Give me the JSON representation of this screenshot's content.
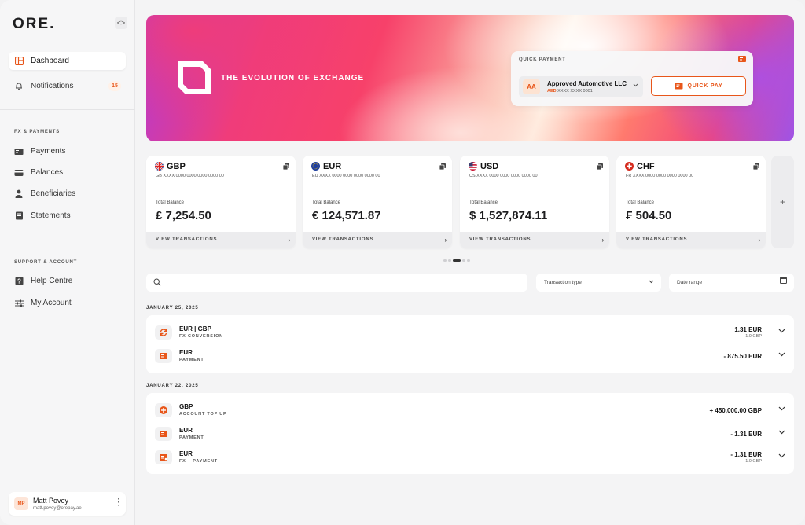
{
  "brand": {
    "logo": "ORE."
  },
  "sidebar": {
    "collapse_icon": "<>",
    "primary": [
      {
        "label": "Dashboard",
        "icon": "dashboard-icon"
      },
      {
        "label": "Notifications",
        "icon": "bell-icon",
        "badge": "15"
      }
    ],
    "fx_section_label": "FX & PAYMENTS",
    "fx_items": [
      {
        "label": "Payments",
        "icon": "payment-icon"
      },
      {
        "label": "Balances",
        "icon": "wallet-icon"
      },
      {
        "label": "Beneficiaries",
        "icon": "person-icon"
      },
      {
        "label": "Statements",
        "icon": "statement-icon"
      }
    ],
    "support_section_label": "SUPPORT & ACCOUNT",
    "support_items": [
      {
        "label": "Help Centre",
        "icon": "help-icon"
      },
      {
        "label": "My Account",
        "icon": "sliders-icon"
      }
    ],
    "user": {
      "initials": "MP",
      "name": "Matt Povey",
      "email": "matt.povey@orepay.ae"
    }
  },
  "hero": {
    "title": "THE EVOLUTION OF EXCHANGE",
    "quick_payment": {
      "label": "QUICK PAYMENT",
      "beneficiary_initials": "AA",
      "beneficiary_name": "Approved Automotive LLC",
      "beneficiary_currency": "AED",
      "beneficiary_account": "XXXX XXXX 0001",
      "button_label": "QUICK PAY"
    }
  },
  "balances": {
    "total_label": "Total Balance",
    "footer_label": "VIEW TRANSACTIONS",
    "add_label": "+",
    "cards": [
      {
        "code": "GBP",
        "iban": "GB XXXX 0000 0000 0000 0000 00",
        "balance": "£ 7,254.50"
      },
      {
        "code": "EUR",
        "iban": "EU XXXX 0000 0000 0000 0000 00",
        "balance": "€ 124,571.87"
      },
      {
        "code": "USD",
        "iban": "US XXXX 0000 0000 0000 0000 00",
        "balance": "$ 1,527,874.11"
      },
      {
        "code": "CHF",
        "iban": "FR XXXX 0000 0000 0000 0000 00",
        "balance": "₣ 504.50"
      }
    ]
  },
  "filters": {
    "search_placeholder": "",
    "transaction_type": "Transaction type",
    "date_range": "Date range"
  },
  "transactions": [
    {
      "date": "JANUARY 25, 2025",
      "items": [
        {
          "title": "EUR | GBP",
          "subtitle": "FX CONVERSION",
          "amount": "1.31 EUR",
          "rate": "1.0 GBP",
          "icon": "exchange-icon"
        },
        {
          "title": "EUR",
          "subtitle": "PAYMENT",
          "amount": "- 875.50 EUR",
          "rate": "",
          "icon": "payment-icon"
        }
      ]
    },
    {
      "date": "JANUARY 22, 2025",
      "items": [
        {
          "title": "GBP",
          "subtitle": "ACCOUNT TOP UP",
          "amount": "+ 450,000.00 GBP",
          "rate": "",
          "icon": "plus-circle-icon"
        },
        {
          "title": "EUR",
          "subtitle": "PAYMENT",
          "amount": "- 1.31 EUR",
          "rate": "",
          "icon": "payment-icon"
        },
        {
          "title": "EUR",
          "subtitle": "FX + PAYMENT",
          "amount": "- 1.31 EUR",
          "rate": "1.0 GBP",
          "icon": "fx-payment-icon"
        }
      ]
    }
  ],
  "colors": {
    "accent": "#e8561a",
    "background": "#f4f4f5",
    "card": "#ffffff"
  }
}
